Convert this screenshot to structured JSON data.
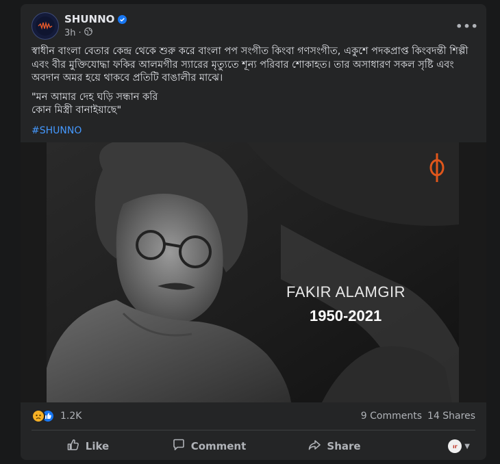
{
  "post": {
    "page_name": "SHUNNO",
    "avatar_text": "SHUNNO",
    "time": "3h",
    "separator": "·",
    "more_label": "•••",
    "body_paragraph": "স্বাধীন বাংলা বেতার কেন্দ্র থেকে শুরু করে বাংলা পপ সংগীত কিংবা গণসংগীত, একুশে পদকপ্রাপ্ত কিংবদন্তী শিল্পী এবং বীর মুক্তিযোদ্ধা ফকির আলমগীর স্যারের মৃত্যুতে শূন্য পরিবার শোকাহত। তার অসাধারণ সকল সৃষ্টি এবং অবদান অমর হয়ে থাকবে প্রতিটি বাঙালীর মাঝে।",
    "quote_line1": "\"মন আমার দেহ ঘড়ি সন্ধান করি",
    "quote_line2": "কোন মিস্ত্রী বানাইয়াছে\"",
    "hashtag": "#SHUNNO"
  },
  "photo": {
    "name": "FAKIR ALAMGIR",
    "years": "1950-2021",
    "logo_color": "#e0561b"
  },
  "stats": {
    "reaction_count": "1.2K",
    "comments": "9 Comments",
    "shares": "14 Shares"
  },
  "actions": {
    "like": "Like",
    "comment": "Comment",
    "share": "Share"
  },
  "audience": {
    "avatar_text": "ır"
  },
  "colors": {
    "background": "#18191a",
    "card": "#242526",
    "text": "#e4e6eb",
    "muted": "#b0b3b8",
    "link": "#4599ff",
    "verified": "#1877f2"
  }
}
